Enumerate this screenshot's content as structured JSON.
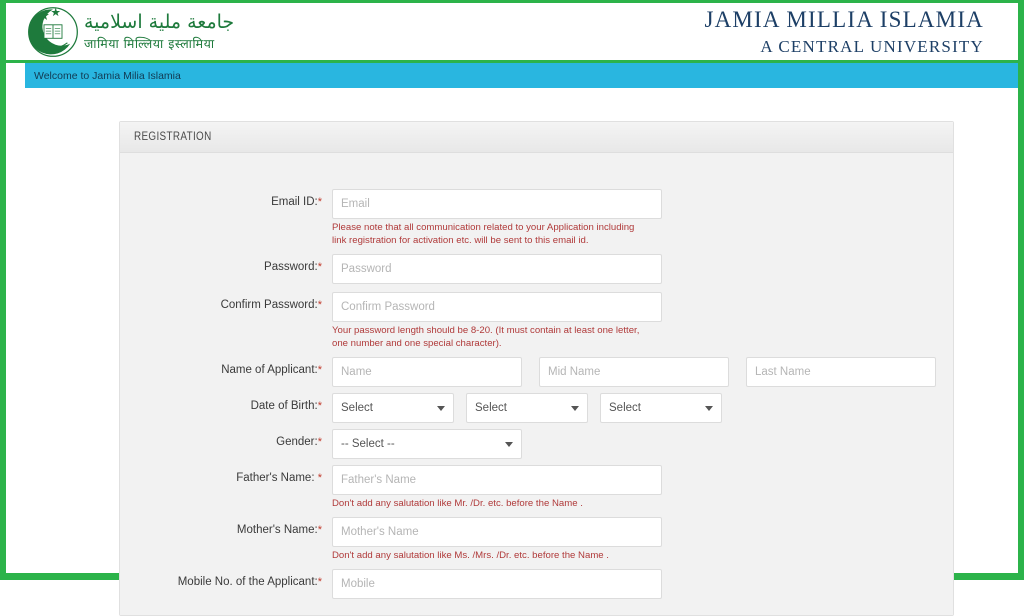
{
  "header": {
    "logo_alt": "jamia-millia-islamia-crest",
    "arabic_title": "جامعة ملية اسلامية",
    "hindi_title": "जामिया मिल्लिया इस्लामिया",
    "english_title_line1": "JAMIA MILLIA ISLAMIA",
    "english_title_line2": "A CENTRAL UNIVERSITY",
    "accent_green": "#2cb34a",
    "title_color": "#1d3f66"
  },
  "welcome": {
    "text": "Welcome to Jamia Milia Islamia",
    "bar_color": "#29b6e0"
  },
  "panel": {
    "title": "REGISTRATION"
  },
  "form": {
    "required_mark": "*",
    "fields": {
      "email": {
        "label": "Email ID:",
        "placeholder": "Email",
        "hint": "Please note that all communication related to your Application including link registration for activation etc. will be sent to this email id."
      },
      "password": {
        "label": "Password:",
        "placeholder": "Password"
      },
      "confirm_password": {
        "label": "Confirm Password:",
        "placeholder": "Confirm Password",
        "hint": "Your password length should be 8-20. (It must contain at least one letter, one number and one special character)."
      },
      "name": {
        "label": "Name of Applicant:",
        "first_placeholder": "Name",
        "middle_placeholder": "Mid Name",
        "last_placeholder": "Last Name"
      },
      "dob": {
        "label": "Date of Birth:",
        "day_value": "Select",
        "month_value": "Select",
        "year_value": "Select"
      },
      "gender": {
        "label": "Gender:",
        "value": "-- Select --"
      },
      "father_name": {
        "label": "Father's Name: ",
        "placeholder": "Father's Name",
        "hint": "Don't add any salutation like Mr. /Dr. etc. before the Name ."
      },
      "mother_name": {
        "label": "Mother's Name:",
        "placeholder": "Mother's Name",
        "hint": "Don't add any salutation like Ms. /Mrs. /Dr. etc. before the Name ."
      },
      "mobile": {
        "label": "Mobile No. of the Applicant:",
        "placeholder": "Mobile"
      }
    }
  }
}
